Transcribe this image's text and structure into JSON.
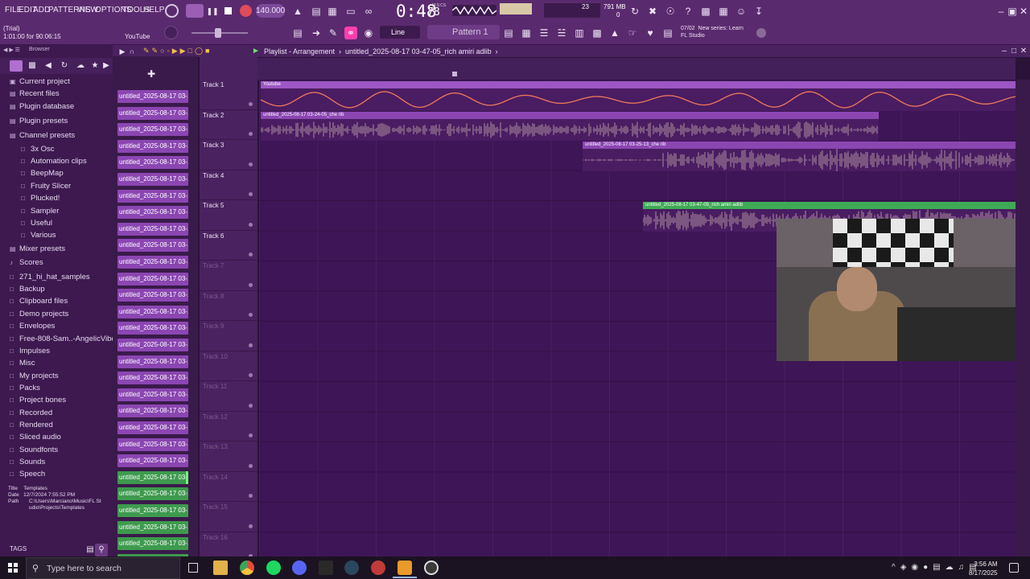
{
  "menu": [
    "FILE",
    "EDIT",
    "ADD",
    "PATTERNS",
    "VIEW",
    "OPTIONS",
    "TOOLS",
    "HELP"
  ],
  "hint": {
    "line1": "(Trial)",
    "line2": "1:01:00 for 90:06:15",
    "source": "YouTube"
  },
  "transport": {
    "tempo": "140.000",
    "time_main": "0:48",
    "time_frac": "78",
    "bars_label": "M:S:CS"
  },
  "cpu": {
    "value": "23",
    "ram": "791 MB",
    "poly": "0"
  },
  "snap": {
    "label": "Line"
  },
  "pattern": {
    "label": "Pattern 1"
  },
  "news": {
    "date": "07/02",
    "line1": "New series: Learn",
    "line2": "FL Studio"
  },
  "browser": {
    "header": "Browser",
    "items": [
      {
        "label": "Current project",
        "icon": "▣",
        "sub": false
      },
      {
        "label": "Recent files",
        "icon": "▤",
        "sub": false
      },
      {
        "label": "Plugin database",
        "icon": "▤",
        "sub": false
      },
      {
        "label": "Plugin presets",
        "icon": "▤",
        "sub": false
      },
      {
        "label": "Channel presets",
        "icon": "▤",
        "sub": false
      },
      {
        "label": "3x Osc",
        "icon": "□",
        "sub": true
      },
      {
        "label": "Automation clips",
        "icon": "□",
        "sub": true
      },
      {
        "label": "BeepMap",
        "icon": "□",
        "sub": true
      },
      {
        "label": "Fruity Slicer",
        "icon": "□",
        "sub": true
      },
      {
        "label": "Plucked!",
        "icon": "□",
        "sub": true
      },
      {
        "label": "Sampler",
        "icon": "□",
        "sub": true
      },
      {
        "label": "Useful",
        "icon": "□",
        "sub": true
      },
      {
        "label": "Various",
        "icon": "□",
        "sub": true
      },
      {
        "label": "Mixer presets",
        "icon": "▤",
        "sub": false
      },
      {
        "label": "Scores",
        "icon": "♪",
        "sub": false
      },
      {
        "label": "271_hi_hat_samples",
        "icon": "□",
        "sub": false
      },
      {
        "label": "Backup",
        "icon": "□",
        "sub": false
      },
      {
        "label": "Clipboard files",
        "icon": "□",
        "sub": false
      },
      {
        "label": "Demo projects",
        "icon": "□",
        "sub": false
      },
      {
        "label": "Envelopes",
        "icon": "□",
        "sub": false
      },
      {
        "label": "Free-808-Sam..-AngelicVibes",
        "icon": "□",
        "sub": false
      },
      {
        "label": "Impulses",
        "icon": "□",
        "sub": false
      },
      {
        "label": "Misc",
        "icon": "□",
        "sub": false
      },
      {
        "label": "My projects",
        "icon": "□",
        "sub": false
      },
      {
        "label": "Packs",
        "icon": "□",
        "sub": false
      },
      {
        "label": "Project bones",
        "icon": "□",
        "sub": false
      },
      {
        "label": "Recorded",
        "icon": "□",
        "sub": false
      },
      {
        "label": "Rendered",
        "icon": "□",
        "sub": false
      },
      {
        "label": "Sliced audio",
        "icon": "□",
        "sub": false
      },
      {
        "label": "Soundfonts",
        "icon": "□",
        "sub": false
      },
      {
        "label": "Sounds",
        "icon": "□",
        "sub": false
      },
      {
        "label": "Speech",
        "icon": "□",
        "sub": false
      }
    ],
    "info": {
      "title_label": "Title",
      "title": "Templates",
      "date_label": "Date",
      "date": "12/7/2024 7:55:52 PM",
      "path_label": "Path",
      "path": "C:\\Users\\Marciano\\Music\\FL Studio\\Projects\\Templates"
    },
    "tags": "TAGS"
  },
  "channels": {
    "clip_label": "untitled_2025-08-17 03-...",
    "count": 29,
    "selected_index": 23
  },
  "playlist": {
    "title": "Playlist - Arrangement",
    "breadcrumb": "untitled_2025-08-17 03-47-05_rich amiri adlib",
    "tracks": [
      "Track 1",
      "Track 2",
      "Track 3",
      "Track 4",
      "Track 5",
      "Track 6",
      "Track 7",
      "Track 8",
      "Track 9",
      "Track 10",
      "Track 11",
      "Track 12",
      "Track 13",
      "Track 14",
      "Track 15",
      "Track 16"
    ],
    "clips": [
      {
        "name": "Youtube",
        "track": 1
      },
      {
        "name": "untitled_2025-08-17 03-24-05_che rib",
        "track": 2
      },
      {
        "name": "untitled_2025-08-17 03-25-13_che rib",
        "track": 3
      },
      {
        "name": "untitled_2025-08-17 03-47-05_rich amiri adlib",
        "track": 5
      }
    ]
  },
  "taskbar": {
    "search_placeholder": "Type here to search",
    "time": "3:56 AM",
    "date": "8/17/2025"
  }
}
